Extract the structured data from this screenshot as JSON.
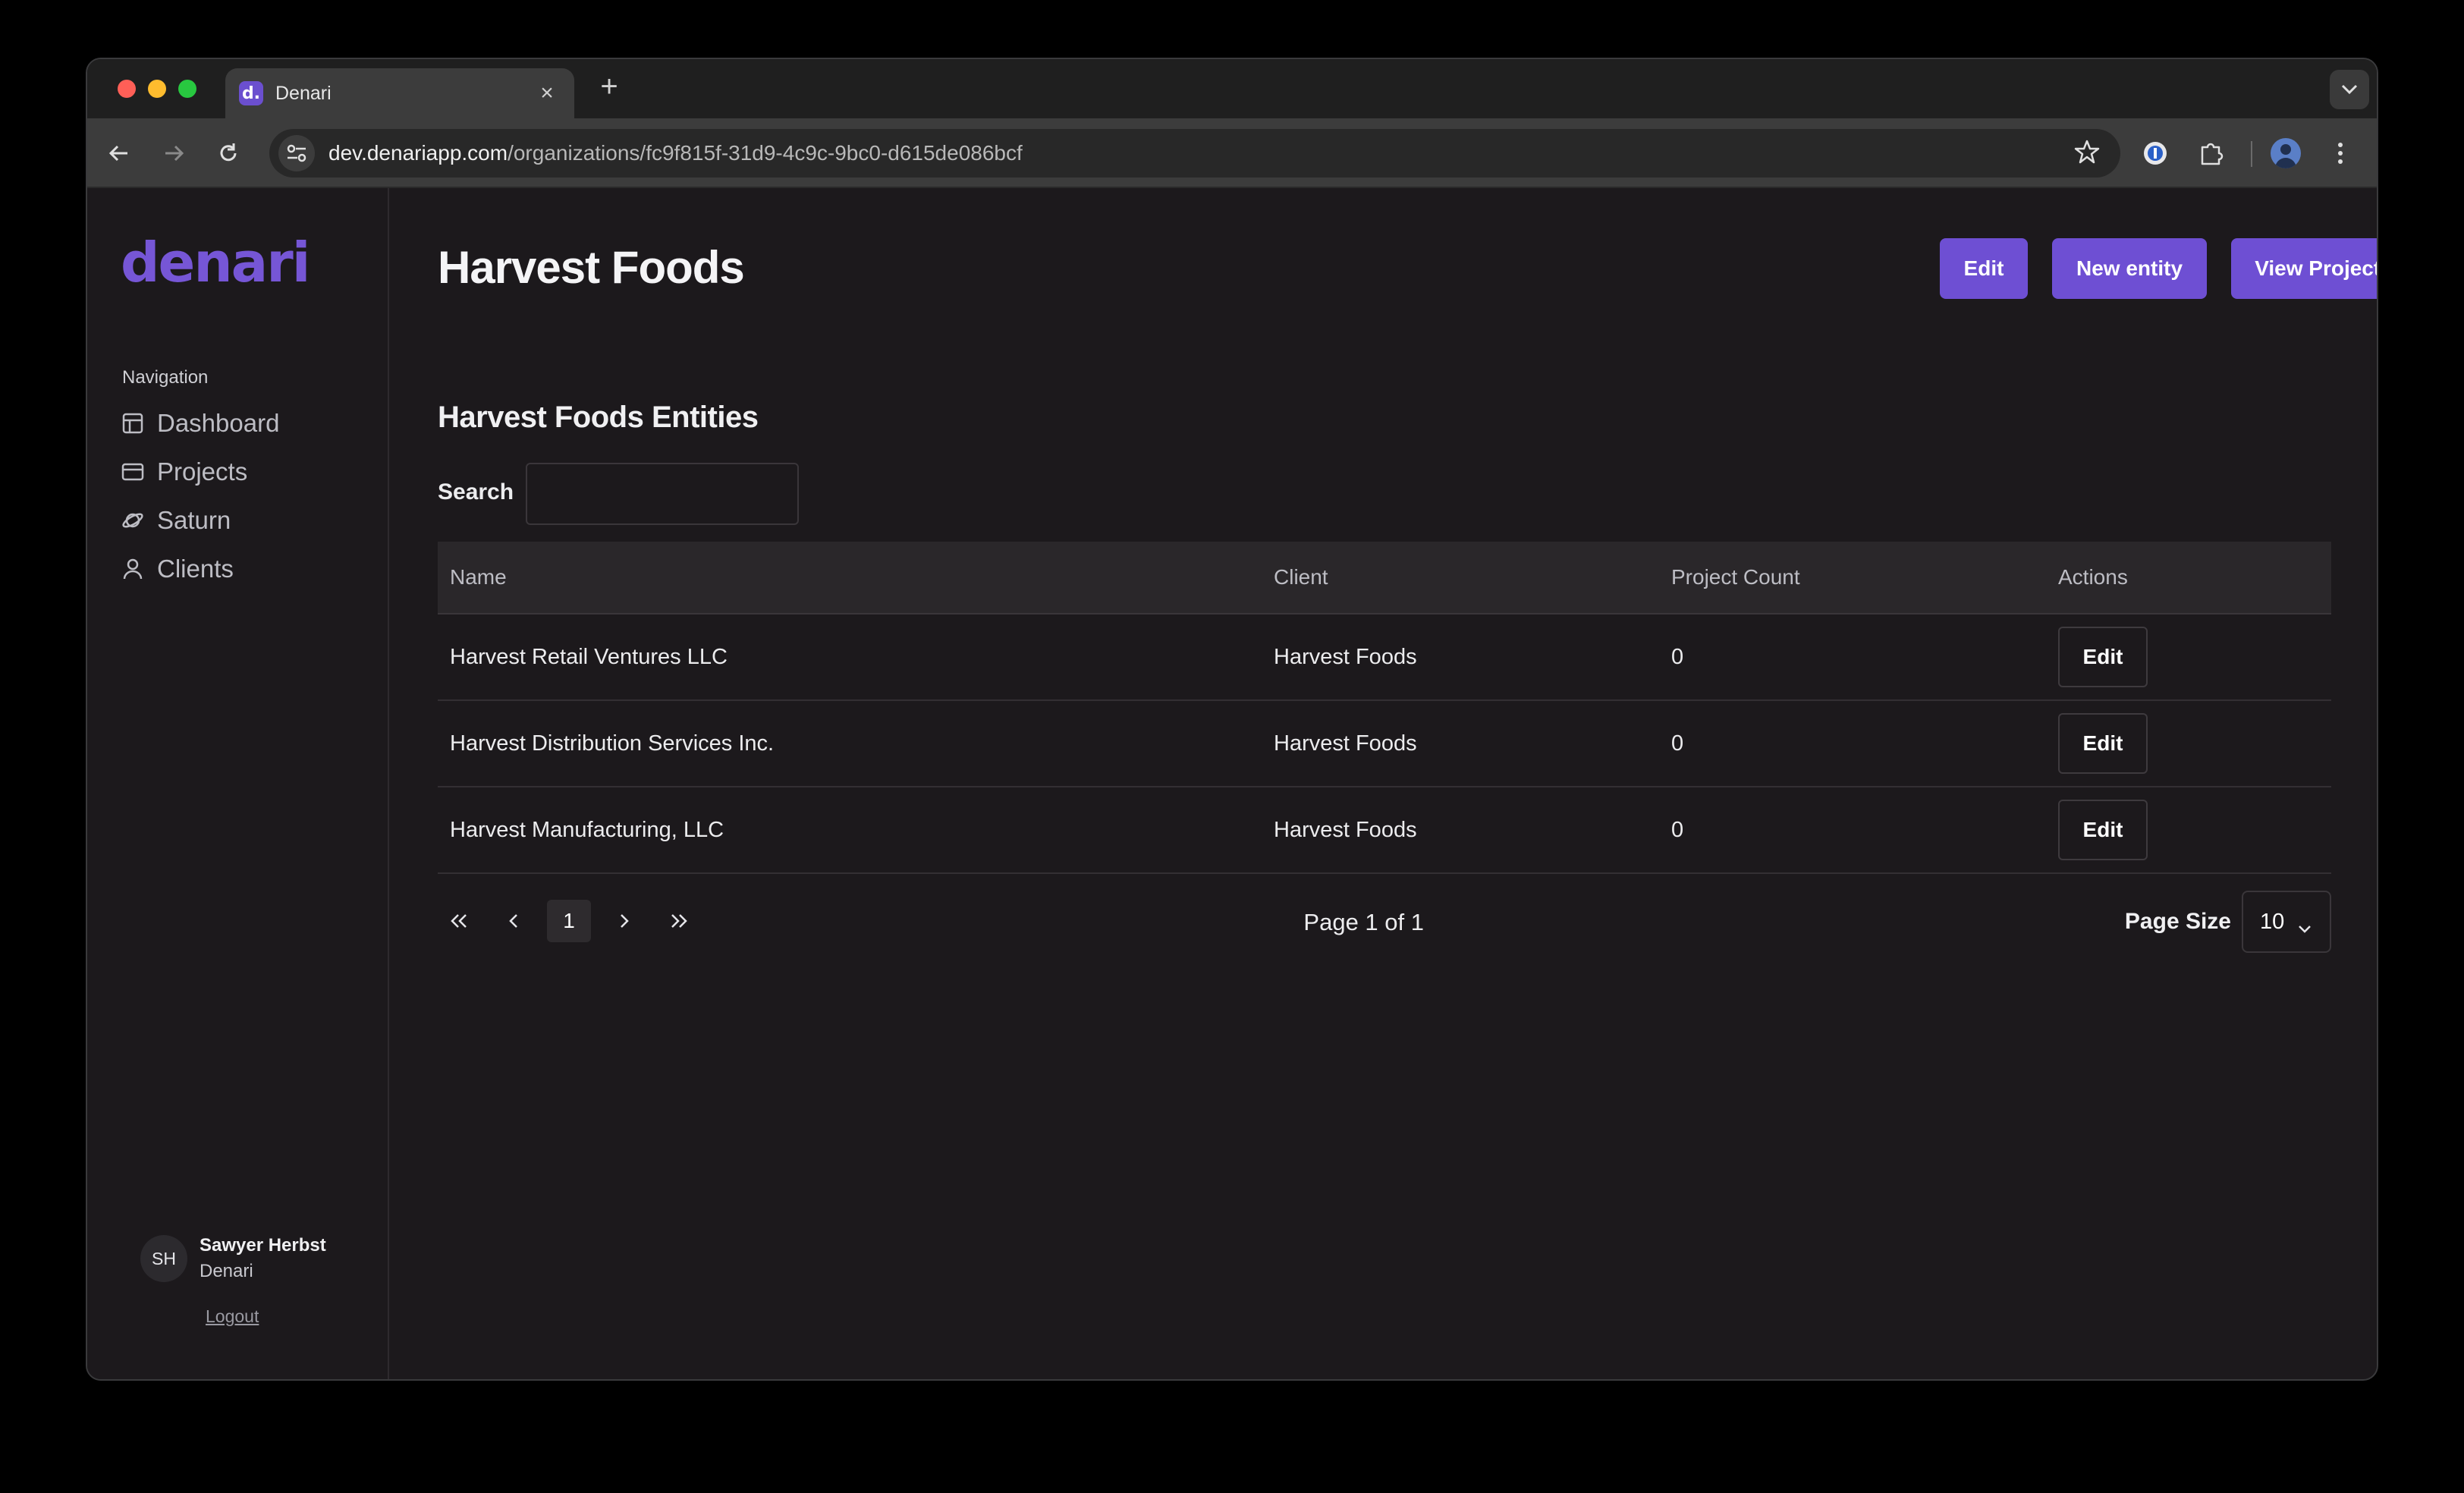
{
  "browser": {
    "tab_title": "Denari",
    "tab_favicon_text": "d.",
    "url_host": "dev.denariapp.com",
    "url_path": "/organizations/fc9f815f-31d9-4c9c-9bc0-d615de086bcf"
  },
  "sidebar": {
    "logo_text": "denari",
    "nav_heading": "Navigation",
    "items": [
      {
        "label": "Dashboard",
        "icon": "dashboard-icon"
      },
      {
        "label": "Projects",
        "icon": "projects-icon"
      },
      {
        "label": "Saturn",
        "icon": "saturn-icon"
      },
      {
        "label": "Clients",
        "icon": "user-icon"
      }
    ],
    "user": {
      "initials": "SH",
      "name": "Sawyer Herbst",
      "org": "Denari"
    },
    "logout_label": "Logout"
  },
  "header": {
    "title": "Harvest Foods",
    "edit_label": "Edit",
    "new_entity_label": "New entity",
    "view_projects_label": "View Projects"
  },
  "entities": {
    "section_title": "Harvest Foods Entities",
    "search_label": "Search",
    "search_value": "",
    "columns": [
      "Name",
      "Client",
      "Project Count",
      "Actions"
    ],
    "rows": [
      {
        "name": "Harvest Retail Ventures LLC",
        "client": "Harvest Foods",
        "project_count": "0",
        "action": "Edit"
      },
      {
        "name": "Harvest Distribution Services Inc.",
        "client": "Harvest Foods",
        "project_count": "0",
        "action": "Edit"
      },
      {
        "name": "Harvest Manufacturing, LLC",
        "client": "Harvest Foods",
        "project_count": "0",
        "action": "Edit"
      }
    ]
  },
  "pagination": {
    "current_page": "1",
    "page_info": "Page 1 of 1",
    "page_size_label": "Page Size",
    "page_size_value": "10"
  },
  "colors": {
    "accent": "#6e4fd3",
    "background": "#1c191c",
    "logo": "#7656d6"
  }
}
